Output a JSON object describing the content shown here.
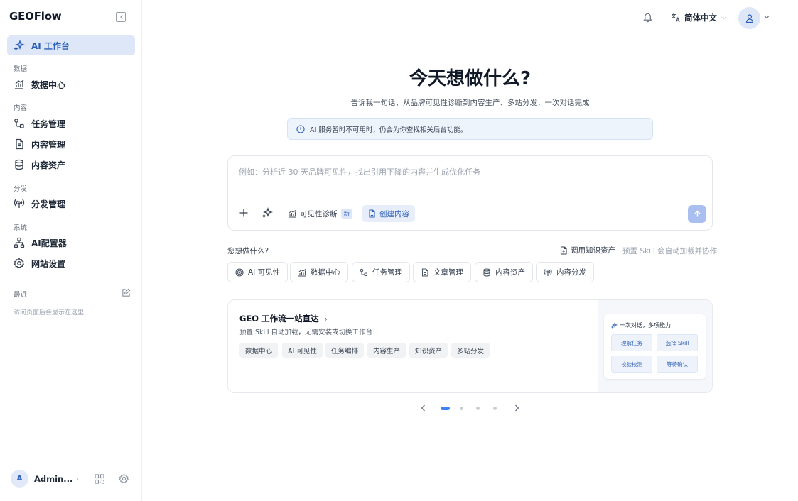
{
  "app": {
    "brand": "GEOFlow"
  },
  "sidebar": {
    "active_item": "AI 工作台",
    "sections": {
      "data": "数据",
      "content": "内容",
      "distribution": "分发",
      "system": "系统"
    },
    "items": [
      {
        "label": "AI 工作台",
        "icon": "sparkle-icon"
      },
      {
        "label": "数据中心",
        "icon": "chart-icon"
      },
      {
        "label": "任务管理",
        "icon": "workflow-icon"
      },
      {
        "label": "内容管理",
        "icon": "document-icon"
      },
      {
        "label": "内容资产",
        "icon": "database-icon"
      },
      {
        "label": "分发管理",
        "icon": "broadcast-icon"
      },
      {
        "label": "AI配置器",
        "icon": "hierarchy-icon"
      },
      {
        "label": "网站设置",
        "icon": "gear-icon"
      }
    ],
    "recent_label": "最近",
    "recent_empty_hint": "访问页面后会显示在这里",
    "user": {
      "initial": "A",
      "name": "Admin..."
    }
  },
  "topbar": {
    "language": "简体中文"
  },
  "main": {
    "title": "今天想做什么?",
    "subtitle": "告诉我一句话，从品牌可见性诊断到内容生产、多站分发，一次对话完成",
    "notice": "AI 服务暂时不可用时，仍会为你查找相关后台功能。",
    "composer": {
      "placeholder": "例如：分析近 30 天品牌可见性，找出引用下降的内容并生成优化任务",
      "value": "",
      "tools": {
        "visibility": "可见性诊断",
        "new_badge": "新",
        "create": "创建内容"
      }
    },
    "quick": {
      "label": "您想做什么?",
      "kb_link": "调用知识资产",
      "kb_hint": "预置 Skill 会自动加载并协作",
      "chips": [
        "AI 可见性",
        "数据中心",
        "任务管理",
        "文章管理",
        "内容资产",
        "内容分发"
      ]
    },
    "card": {
      "title": "GEO 工作流一站直达",
      "subtitle": "预置 Skill 自动加载，无需安装或切换工作台",
      "tags": [
        "数据中心",
        "AI 可见性",
        "任务编排",
        "内容生产",
        "知识资产",
        "多站分发"
      ],
      "panel_title": "一次对话，多项能力",
      "panel_buttons": [
        "理解任务",
        "选择 Skill",
        "校验校测",
        "等待确认"
      ]
    },
    "pager": {
      "pages": 4,
      "current": 1
    }
  },
  "colors": {
    "accent": "#2d5fb8",
    "active_bg": "#dde7f7",
    "send_button": "#a9bff0",
    "pager_active": "#3b82f6"
  }
}
